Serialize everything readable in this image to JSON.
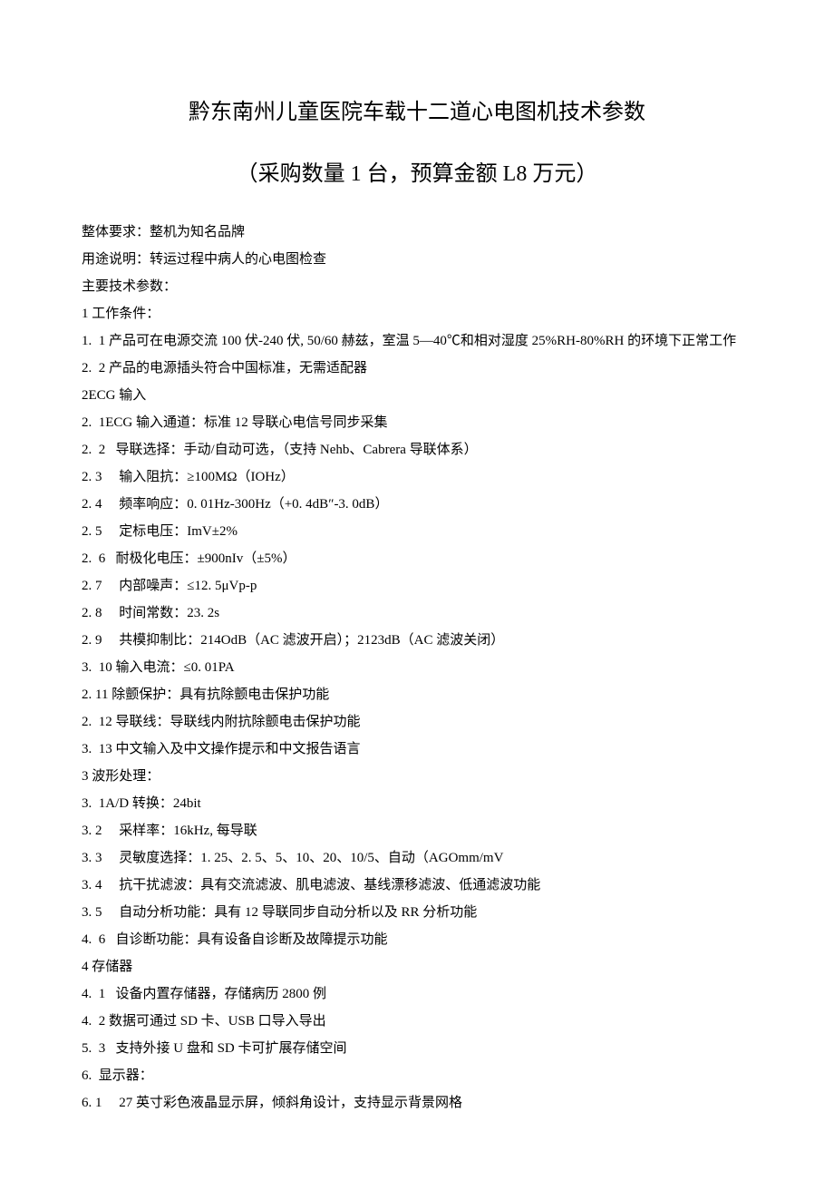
{
  "title": "黔东南州儿童医院车载十二道心电图机技术参数",
  "subtitle": "（采购数量 1 台，预算金额 L8 万元）",
  "lines": [
    "整体要求：整机为知名品牌",
    "用途说明：转运过程中病人的心电图检查",
    "主要技术参数：",
    "1 工作条件：",
    "1.  1 产品可在电源交流 100 伏-240 伏, 50/60 赫兹，室温 5—40℃和相对湿度 25%RH-80%RH 的环境下正常工作",
    "2.  2 产品的电源插头符合中国标准，无需适配器",
    "2ECG 输入",
    "2.  1ECG 输入通道：标准 12 导联心电信号同步采集",
    "2.  2   导联选择：手动/自动可选，（支持 Nehb、Cabrera 导联体系）",
    "2. 3     输入阻抗：≥100MΩ（IOHz）",
    "2. 4     频率响应：0. 01Hz-300Hz（+0. 4dB″-3. 0dB）",
    "2. 5     定标电压：ImV±2%",
    "2.  6   耐极化电压：±900nIv（±5%）",
    "2. 7     内部噪声：≤12. 5μVp-p",
    "2. 8     时间常数：23. 2s",
    "2. 9     共模抑制比：214OdB（AC 滤波开启）；2123dB（AC 滤波关闭）",
    "3.  10 输入电流：≤0. 01PA",
    "2. 11 除颤保护：具有抗除颤电击保护功能",
    "2.  12 导联线：导联线内附抗除颤电击保护功能",
    "3.  13 中文输入及中文操作提示和中文报告语言",
    "3 波形处理：",
    "3.  1A/D 转换：24bit",
    "3. 2     采样率：16kHz, 每导联",
    "3. 3     灵敏度选择：1. 25、2. 5、5、10、20、10/5、自动（AGOmm/mV",
    "3. 4     抗干扰滤波：具有交流滤波、肌电滤波、基线漂移滤波、低通滤波功能",
    "3. 5     自动分析功能：具有 12 导联同步自动分析以及 RR 分析功能",
    "4.  6   自诊断功能：具有设备自诊断及故障提示功能",
    "4 存储器",
    "4.  1   设备内置存储器，存储病历 2800 例",
    "4.  2 数据可通过 SD 卡、USB 口导入导出",
    "5.  3   支持外接 U 盘和 SD 卡可扩展存储空间",
    "6.  显示器：",
    "6. 1     27 英寸彩色液晶显示屏，倾斜角设计，支持显示背景网格"
  ]
}
